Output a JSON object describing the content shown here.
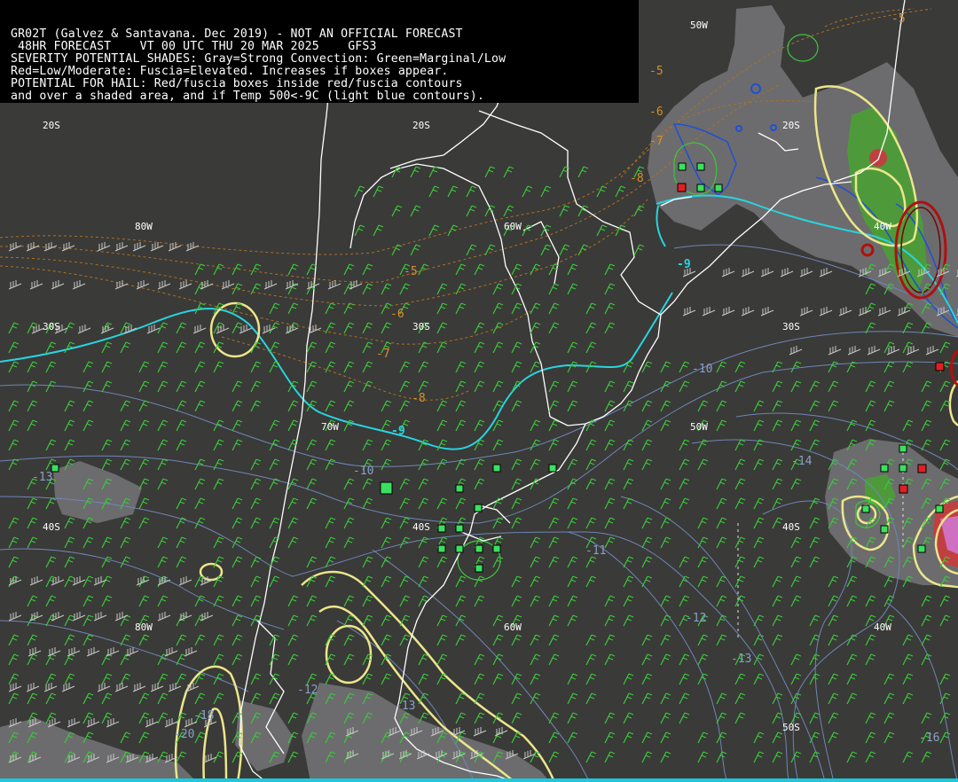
{
  "header": {
    "line1": "GR02T (Galvez & Santavana. Dec 2019) - NOT AN OFFICIAL FORECAST",
    "line2": " 48HR FORECAST    VT 00 UTC THU 20 MAR 2025    GFS3",
    "line3": "SEVERITY POTENTIAL SHADES: Gray=Strong Convection: Green=Marginal/Low",
    "line4": "Red=Low/Moderate: Fuscia=Elevated. Increases if boxes appear.",
    "line5": "POTENTIAL FOR HAIL: Red/fuscia boxes inside red/fuscia contours",
    "line6": "and over a shaded area, and if Temp 500<-9C (light blue contours)."
  },
  "grid_labels": {
    "lat_20s_a": "20S",
    "lat_20s_b": "20S",
    "lat_20s_c": "20S",
    "lat_30s_a": "30S",
    "lat_30s_b": "30S",
    "lat_30s_c": "30S",
    "lat_40s_a": "40S",
    "lat_40s_b": "40S",
    "lat_40s_c": "40S",
    "lat_50s": "50S",
    "lon_80w_a": "80W",
    "lon_80w_b": "80W",
    "lon_70w": "70W",
    "lon_60w_a": "60W",
    "lon_60w_b": "60W",
    "lon_50w_a": "50W",
    "lon_50w_b": "50W",
    "lon_40w_a": "40W",
    "lon_40w_b": "40W"
  },
  "contour_labels": {
    "orange_m5_a": "-5",
    "orange_m5_b": "-5",
    "orange_m5_c": "-5",
    "orange_m6_a": "-6",
    "orange_m6_b": "-6",
    "orange_m7_a": "-7",
    "orange_m7_b": "-7",
    "orange_m8_a": "-8",
    "orange_m8_b": "-8",
    "cyan_m9_a": "-9",
    "cyan_m9_b": "-9",
    "blue_m10_a": "-10",
    "blue_m10_b": "-10",
    "blue_m11": "-11",
    "blue_m12_a": "-12",
    "blue_m12_b": "-12",
    "blue_m13_a": "-13",
    "blue_m13_b": "-13",
    "blue_m14": "-14",
    "blue_m16": "-16",
    "blue_m18": "-18",
    "blue_m20": "-20",
    "blue_m13_left": "-13"
  },
  "colors": {
    "background": "#3a3a38",
    "header_bg": "#000000",
    "gray_shade": "#6e6e70",
    "green_shade": "#4e9a3a",
    "red_contour": "#b01010",
    "yellow_contour": "#f0e68a",
    "cyan_contour": "#27d5e0",
    "blue_contour": "#7890c0",
    "orange_contour": "#d8902a",
    "wind_barbs_green": "#3cc83c",
    "wind_barbs_gray": "#c8c8c8",
    "coastline": "#ffffff"
  }
}
